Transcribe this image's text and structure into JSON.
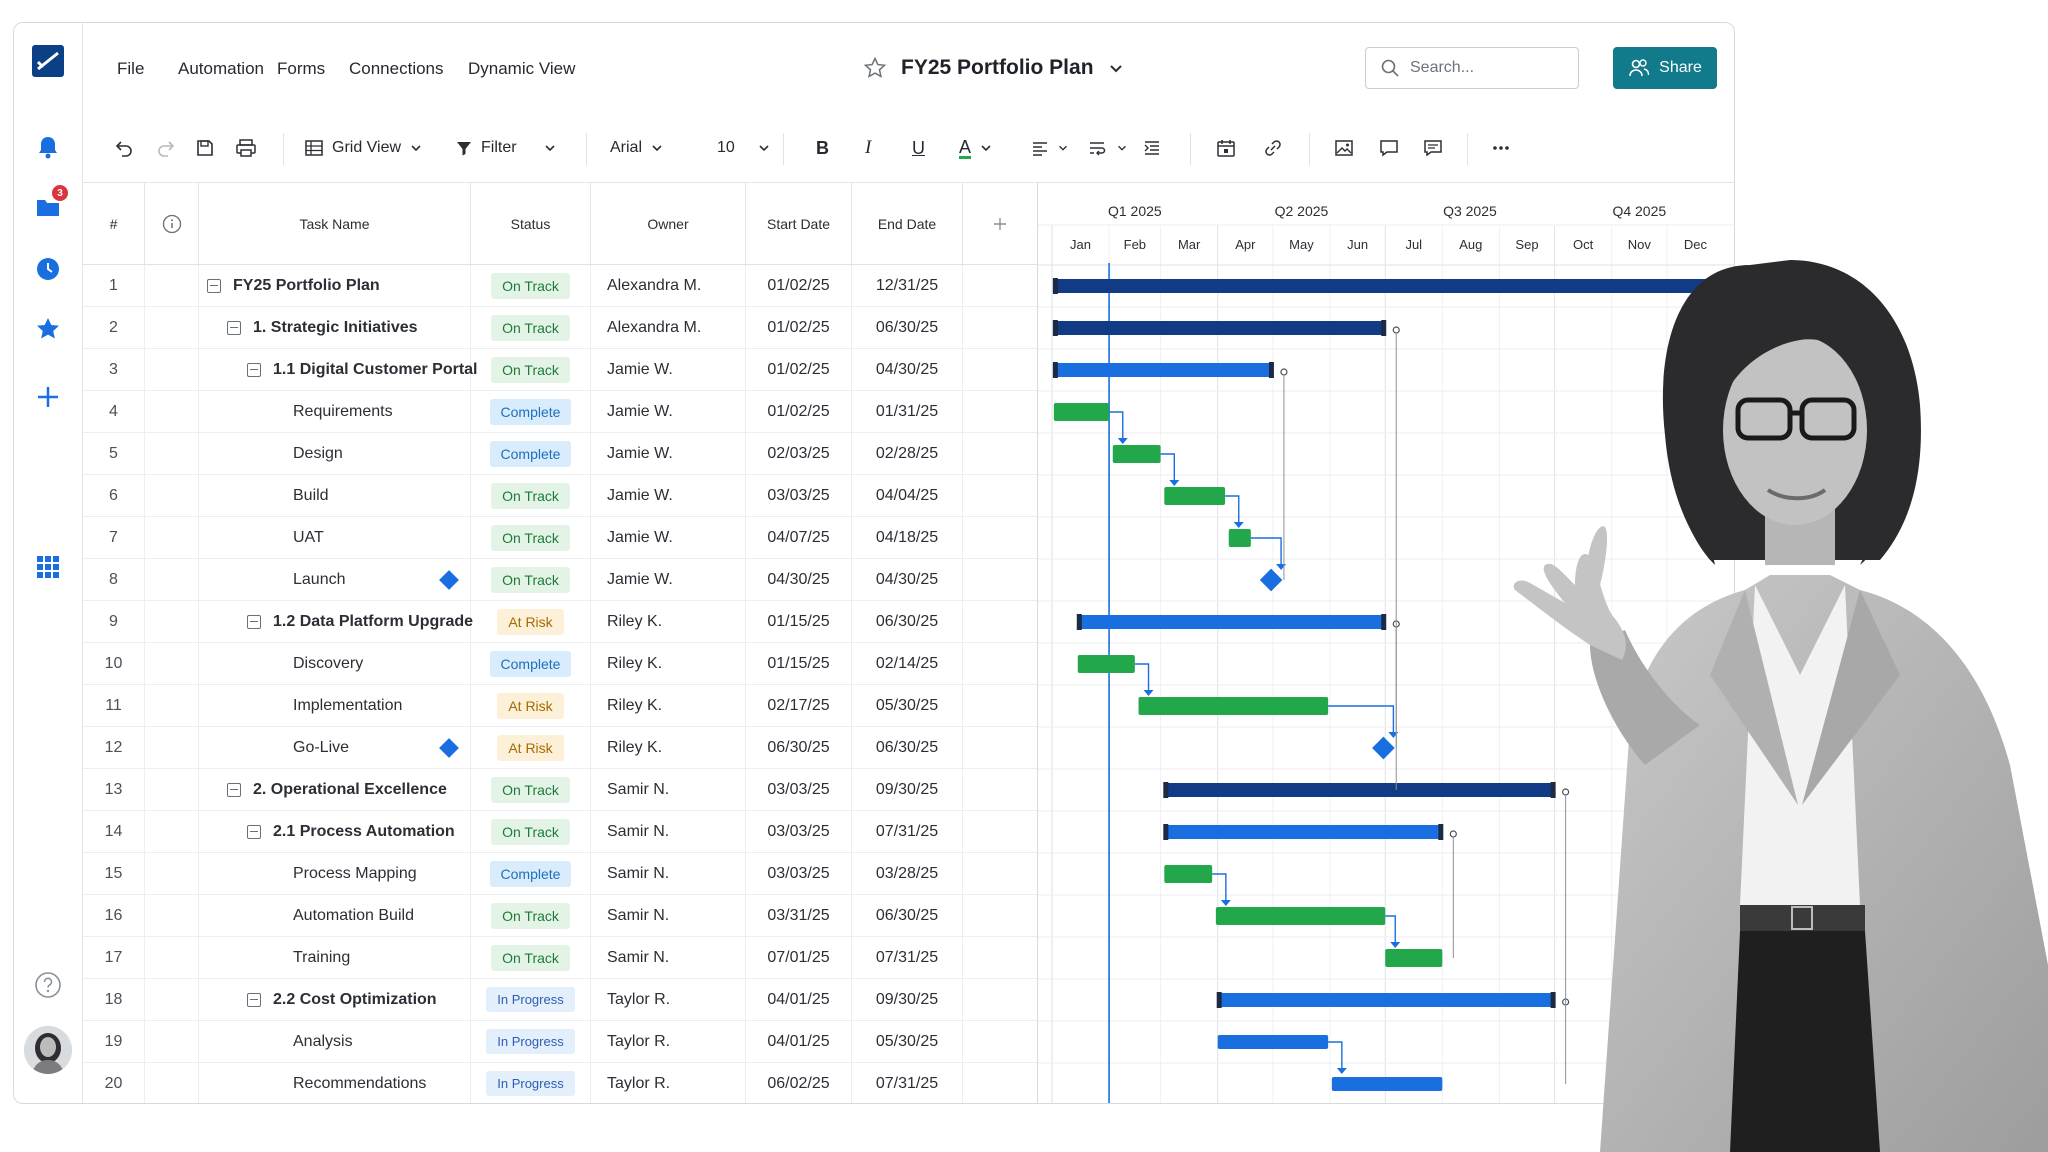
{
  "menu": [
    "File",
    "Automation",
    "Forms",
    "Connections",
    "Dynamic View"
  ],
  "sheet": {
    "title": "FY25 Portfolio Plan"
  },
  "search": {
    "placeholder": "Search..."
  },
  "share": {
    "label": "Share"
  },
  "rail": {
    "notification_count": "3"
  },
  "toolbar": {
    "view_label": "Grid View",
    "filter_label": "Filter",
    "font_family": "Arial",
    "font_size": "10",
    "bold": "B",
    "italic": "I",
    "underline": "U",
    "text_color": "A"
  },
  "columns": {
    "num": "#",
    "task": "Task Name",
    "status": "Status",
    "owner": "Owner",
    "start": "Start Date",
    "end": "End Date"
  },
  "status_colors": {
    "On Track": "#1e7a39",
    "Complete": "#1e6fbf",
    "At Risk": "#a66a00",
    "In Progress": "#2c5fb3"
  },
  "bar_colors": {
    "summary_dark": "#123b86",
    "summary": "#1a6fe0",
    "task": "#22a74a",
    "milestone": "#1a6fe0"
  },
  "timeline": {
    "quarters": [
      "Q1 2025",
      "Q2 2025",
      "Q3 2025",
      "Q4 2025"
    ],
    "months": [
      "Jan",
      "Feb",
      "Mar",
      "Apr",
      "May",
      "Jun",
      "Jul",
      "Aug",
      "Sep",
      "Oct",
      "Nov",
      "Dec"
    ],
    "today": "02/01/25"
  },
  "rows": [
    {
      "num": "1",
      "task": "FY25 Portfolio Plan",
      "level": 0,
      "summary": true,
      "status": "On Track",
      "owner": "Alexandra M.",
      "start": "01/02/25",
      "end": "12/31/25",
      "kind": "summary_dark"
    },
    {
      "num": "2",
      "task": "1. Strategic Initiatives",
      "level": 1,
      "summary": true,
      "status": "On Track",
      "owner": "Alexandra M.",
      "start": "01/02/25",
      "end": "06/30/25",
      "kind": "summary_dark"
    },
    {
      "num": "3",
      "task": "1.1 Digital Customer Portal",
      "level": 2,
      "summary": true,
      "status": "On Track",
      "owner": "Jamie W.",
      "start": "01/02/25",
      "end": "04/30/25",
      "kind": "summary"
    },
    {
      "num": "4",
      "task": "Requirements",
      "level": 3,
      "summary": false,
      "status": "Complete",
      "owner": "Jamie W.",
      "start": "01/02/25",
      "end": "01/31/25",
      "kind": "task"
    },
    {
      "num": "5",
      "task": "Design",
      "level": 3,
      "summary": false,
      "status": "Complete",
      "owner": "Jamie W.",
      "start": "02/03/25",
      "end": "02/28/25",
      "kind": "task"
    },
    {
      "num": "6",
      "task": "Build",
      "level": 3,
      "summary": false,
      "status": "On Track",
      "owner": "Jamie W.",
      "start": "03/03/25",
      "end": "04/04/25",
      "kind": "task"
    },
    {
      "num": "7",
      "task": "UAT",
      "level": 3,
      "summary": false,
      "status": "On Track",
      "owner": "Jamie W.",
      "start": "04/07/25",
      "end": "04/18/25",
      "kind": "task"
    },
    {
      "num": "8",
      "task": "Launch",
      "level": 3,
      "summary": false,
      "status": "On Track",
      "owner": "Jamie W.",
      "start": "04/30/25",
      "end": "04/30/25",
      "kind": "milestone"
    },
    {
      "num": "9",
      "task": "1.2 Data Platform Upgrade",
      "level": 2,
      "summary": true,
      "status": "At Risk",
      "owner": "Riley K.",
      "start": "01/15/25",
      "end": "06/30/25",
      "kind": "summary"
    },
    {
      "num": "10",
      "task": "Discovery",
      "level": 3,
      "summary": false,
      "status": "Complete",
      "owner": "Riley K.",
      "start": "01/15/25",
      "end": "02/14/25",
      "kind": "task"
    },
    {
      "num": "11",
      "task": "Implementation",
      "level": 3,
      "summary": false,
      "status": "At Risk",
      "owner": "Riley K.",
      "start": "02/17/25",
      "end": "05/30/25",
      "kind": "task"
    },
    {
      "num": "12",
      "task": "Go-Live",
      "level": 3,
      "summary": false,
      "status": "At Risk",
      "owner": "Riley K.",
      "start": "06/30/25",
      "end": "06/30/25",
      "kind": "milestone"
    },
    {
      "num": "13",
      "task": "2. Operational Excellence",
      "level": 1,
      "summary": true,
      "status": "On Track",
      "owner": "Samir N.",
      "start": "03/03/25",
      "end": "09/30/25",
      "kind": "summary_dark"
    },
    {
      "num": "14",
      "task": "2.1 Process Automation",
      "level": 2,
      "summary": true,
      "status": "On Track",
      "owner": "Samir N.",
      "start": "03/03/25",
      "end": "07/31/25",
      "kind": "summary"
    },
    {
      "num": "15",
      "task": "Process Mapping",
      "level": 3,
      "summary": false,
      "status": "Complete",
      "owner": "Samir N.",
      "start": "03/03/25",
      "end": "03/28/25",
      "kind": "task"
    },
    {
      "num": "16",
      "task": "Automation Build",
      "level": 3,
      "summary": false,
      "status": "On Track",
      "owner": "Samir N.",
      "start": "03/31/25",
      "end": "06/30/25",
      "kind": "task"
    },
    {
      "num": "17",
      "task": "Training",
      "level": 3,
      "summary": false,
      "status": "On Track",
      "owner": "Samir N.",
      "start": "07/01/25",
      "end": "07/31/25",
      "kind": "task"
    },
    {
      "num": "18",
      "task": "2.2 Cost Optimization",
      "level": 2,
      "summary": true,
      "status": "In Progress",
      "owner": "Taylor R.",
      "start": "04/01/25",
      "end": "09/30/25",
      "kind": "summary"
    },
    {
      "num": "19",
      "task": "Analysis",
      "level": 3,
      "summary": false,
      "status": "In Progress",
      "owner": "Taylor R.",
      "start": "04/01/25",
      "end": "05/30/25",
      "kind": "summary"
    },
    {
      "num": "20",
      "task": "Recommendations",
      "level": 3,
      "summary": false,
      "status": "In Progress",
      "owner": "Taylor R.",
      "start": "06/02/25",
      "end": "07/31/25",
      "kind": "summary"
    }
  ]
}
